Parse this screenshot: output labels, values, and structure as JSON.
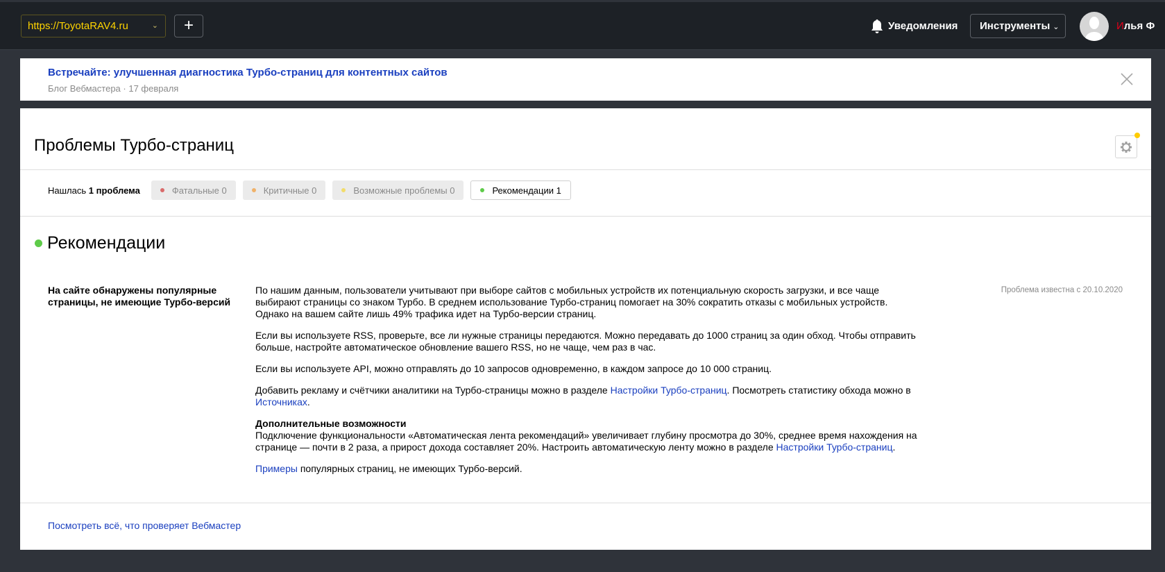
{
  "header": {
    "site": "https://ToyotaRAV4.ru",
    "add_label": "+",
    "notifications": "Уведомления",
    "tools": "Инструменты",
    "user_first_letter": "И",
    "user_rest": "лья Ф"
  },
  "banner": {
    "title": "Встречайте: улучшенная диагностика Турбо-страниц для контентных сайтов",
    "subtitle": "Блог Вебмастера · 17 февраля"
  },
  "page": {
    "title": "Проблемы Турбо-страниц"
  },
  "filters": {
    "found_prefix": "Нашлась ",
    "found_bold": "1 проблема",
    "chips": [
      {
        "label": "Фатальные 0",
        "color": "#d96b6b"
      },
      {
        "label": "Критичные 0",
        "color": "#f0b26a"
      },
      {
        "label": "Возможные проблемы 0",
        "color": "#f2dc6b"
      },
      {
        "label": "Рекомендации 1",
        "color": "#5ecb49"
      }
    ]
  },
  "section": {
    "title": "Рекомендации",
    "color": "#5ecb49"
  },
  "issue": {
    "label": "На сайте обнаружены популярные страницы, не имеющие Турбо-версий",
    "date": "Проблема известна с 20.10.2020",
    "p1": "По нашим данным, пользователи учитывают при выборе сайтов с мобильных устройств их потенциальную скорость загрузки, и все чаще выбирают страницы со знаком Турбо. В среднем использование Турбо-страниц помогает на 30% сократить отказы с мобильных устройств. Однако на вашем сайте лишь 49% трафика идет на Турбо-версии страниц.",
    "p2": "Если вы используете RSS, проверьте, все ли нужные страницы передаются. Можно передавать до 1000 страниц за один обход. Чтобы отправить больше, настройте автоматическое обновление вашего RSS, но не чаще, чем раз в час.",
    "p3": "Если вы используете API, можно отправлять до 10 запросов одновременно, в каждом запросе до 10 000 страниц.",
    "p4_a": "Добавить рекламу и счётчики аналитики на Турбо-страницы можно в разделе ",
    "p4_link1": "Настройки Турбо-страниц",
    "p4_b": ". Посмотреть статистику обхода можно в ",
    "p4_link2": "Источниках",
    "p4_c": ".",
    "extra_title": "Дополнительные возможности",
    "p5_a": "Подключение функциональности «Автоматическая лента рекомендаций» увеличивает глубину просмотра до 30%, среднее время нахождения на странице — почти в 2 раза, а прирост дохода составляет 20%. Настроить автоматическую ленту можно в разделе ",
    "p5_link": "Настройки Турбо-страниц",
    "p5_b": ".",
    "p6_link": "Примеры",
    "p6_b": " популярных страниц, не имеющих Турбо-версий."
  },
  "footer": {
    "link": "Посмотреть всё, что проверяет Вебмастер"
  }
}
